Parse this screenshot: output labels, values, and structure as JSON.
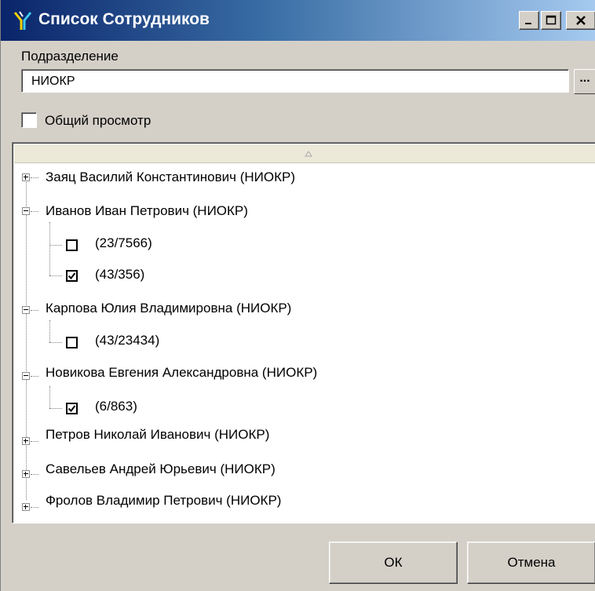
{
  "window": {
    "title": "Список Сотрудников",
    "icon": "turnstile-icon"
  },
  "department": {
    "label": "Подразделение",
    "value": "НИОКР",
    "browse_label": "..."
  },
  "general_view": {
    "label": "Общий просмотр",
    "checked": false
  },
  "employees": [
    {
      "name": "Заяц Василий Константинович (НИОКР)",
      "expanded": false,
      "cards": []
    },
    {
      "name": "Иванов Иван Петрович (НИОКР)",
      "expanded": true,
      "cards": [
        {
          "label": "(23/7566)",
          "checked": false
        },
        {
          "label": "(43/356)",
          "checked": true
        }
      ]
    },
    {
      "name": "Карпова Юлия Владимировна (НИОКР)",
      "expanded": true,
      "cards": [
        {
          "label": "(43/23434)",
          "checked": false
        }
      ]
    },
    {
      "name": "Новикова Евгения Александровна (НИОКР)",
      "expanded": true,
      "cards": [
        {
          "label": "(6/863)",
          "checked": true
        }
      ]
    },
    {
      "name": "Петров Николай Иванович (НИОКР)",
      "expanded": false,
      "cards": []
    },
    {
      "name": "Савельев Андрей Юрьевич (НИОКР)",
      "expanded": false,
      "cards": []
    },
    {
      "name": "Фролов Владимир Петрович (НИОКР)",
      "expanded": false,
      "cards": []
    }
  ],
  "footer": {
    "ok_label": "ОК",
    "cancel_label": "Отмена"
  }
}
